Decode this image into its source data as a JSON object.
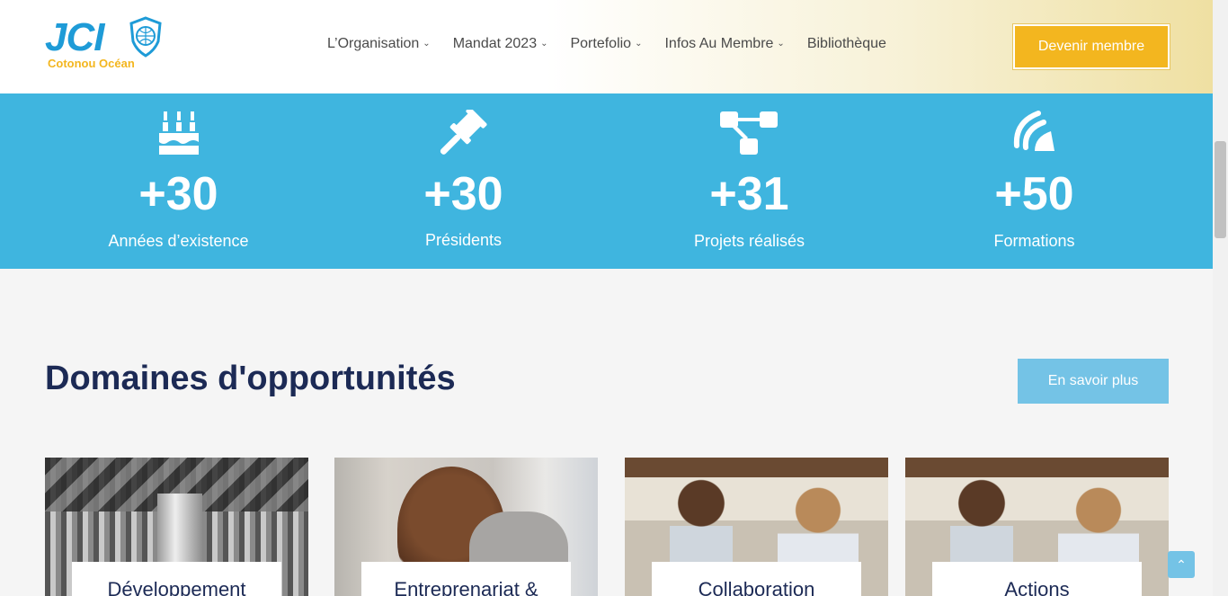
{
  "brand": {
    "name": "JCI",
    "tagline": "Cotonou Océan",
    "accent": "#f3b61f",
    "primary": "#1e9bd7"
  },
  "nav": {
    "items": [
      {
        "label": "L’Organisation",
        "has_dropdown": true
      },
      {
        "label": "Mandat 2023",
        "has_dropdown": true
      },
      {
        "label": "Portefolio",
        "has_dropdown": true
      },
      {
        "label": "Infos Au Membre",
        "has_dropdown": true
      },
      {
        "label": "Bibliothèque",
        "has_dropdown": false
      }
    ],
    "cta_label": "Devenir membre"
  },
  "stats": [
    {
      "icon": "birthday-cake-icon",
      "value": "+30",
      "label": "Années d’existence"
    },
    {
      "icon": "gavel-icon",
      "value": "+30",
      "label": "Présidents"
    },
    {
      "icon": "project-diagram-icon",
      "value": "+31",
      "label": "Projets réalisés"
    },
    {
      "icon": "satellite-dish-icon",
      "value": "+50",
      "label": "Formations"
    }
  ],
  "section": {
    "title": "Domaines d'opportunités",
    "more_label": "En savoir plus"
  },
  "cards": [
    {
      "caption": "Développement"
    },
    {
      "caption": "Entreprenariat &"
    },
    {
      "caption": "Collaboration"
    },
    {
      "caption": "Actions"
    }
  ],
  "colors": {
    "stats_band": "#3fb5df",
    "title": "#1c2a55",
    "button_blue": "#74c3e6"
  }
}
